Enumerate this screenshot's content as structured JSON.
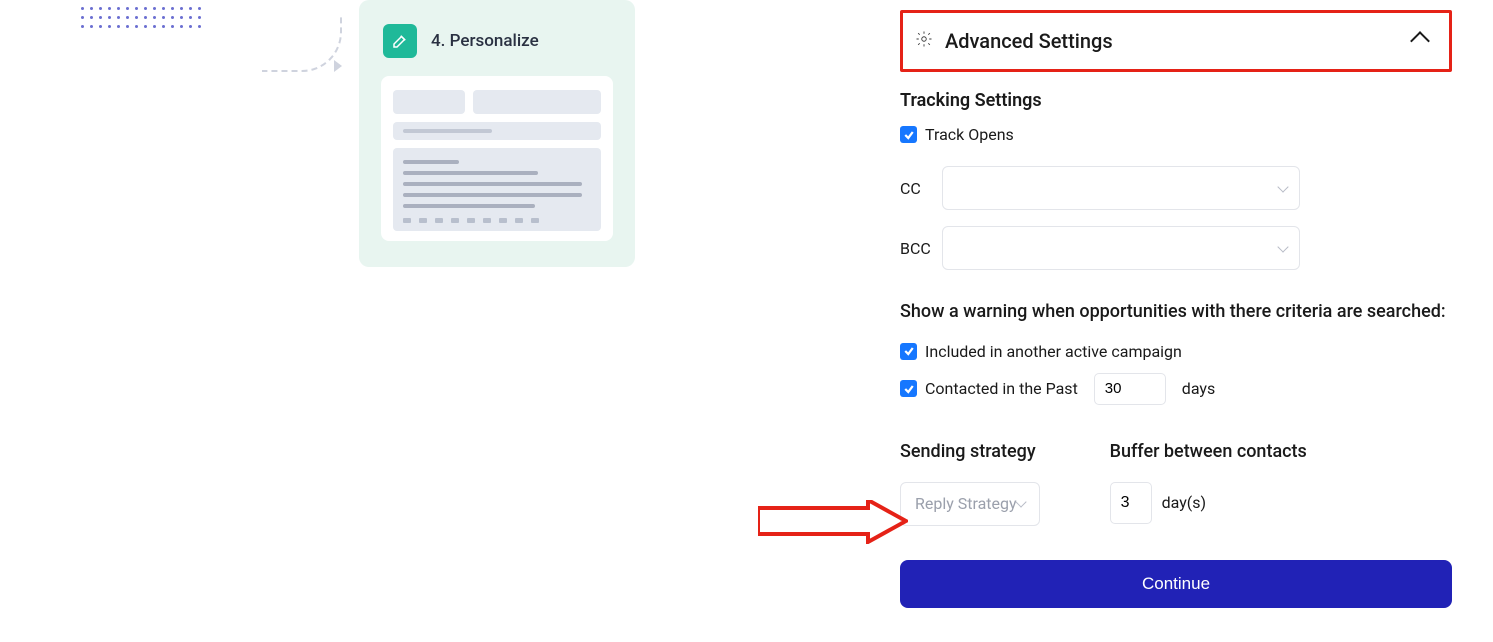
{
  "step": {
    "number_label": "4. Personalize",
    "icon_name": "edit-icon"
  },
  "settings": {
    "advanced_title": "Advanced Settings",
    "tracking": {
      "heading": "Tracking Settings",
      "track_opens_label": "Track Opens",
      "track_opens_checked": true,
      "cc_label": "CC",
      "bcc_label": "BCC"
    },
    "warning": {
      "text": "Show a warning when opportunities with there criteria are searched:",
      "included_label": "Included in another active campaign",
      "included_checked": true,
      "contacted_prefix": "Contacted in the Past",
      "contacted_value": "30",
      "contacted_suffix": "days",
      "contacted_checked": true
    },
    "strategy": {
      "label": "Sending strategy",
      "placeholder": "Reply Strategy"
    },
    "buffer": {
      "label": "Buffer between contacts",
      "value": "3",
      "unit": "day(s)"
    },
    "continue_label": "Continue"
  },
  "colors": {
    "accent_blue": "#1677ff",
    "brand_blue": "#2122b6",
    "teal": "#1fb999",
    "highlight_red": "#e52217"
  }
}
